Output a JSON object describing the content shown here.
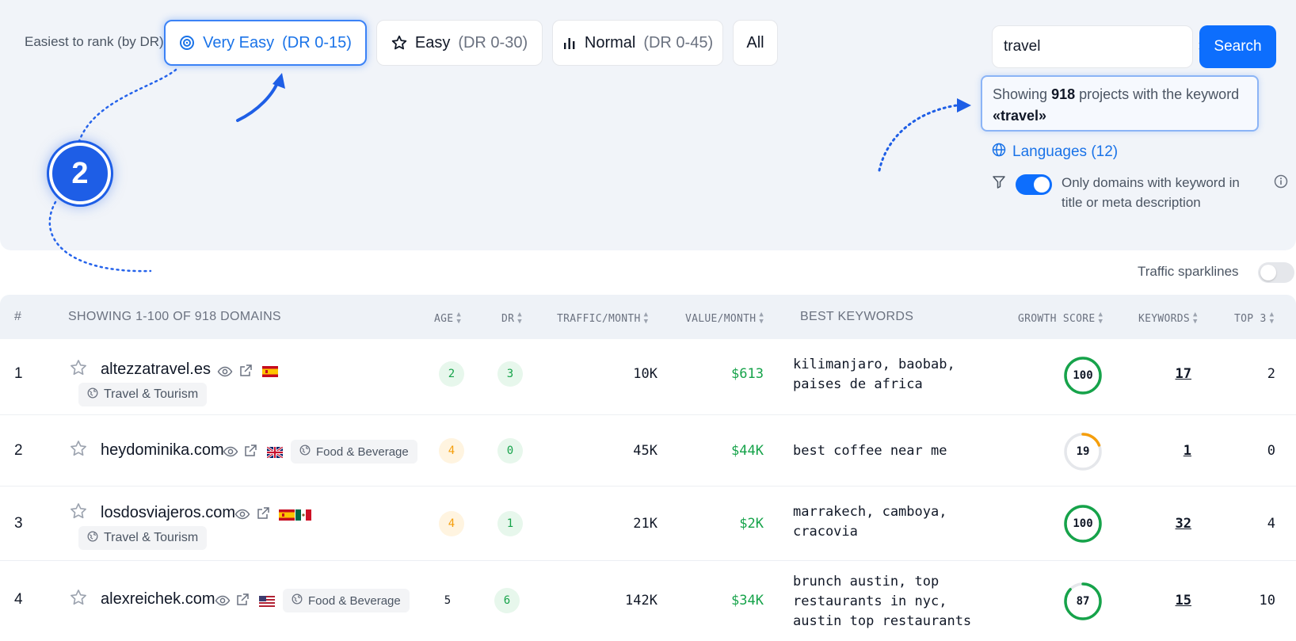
{
  "filters": {
    "label": "Easiest to rank (by DR):",
    "options": [
      {
        "name": "Very Easy",
        "range": "(DR 0-15)",
        "icon": "target-icon",
        "active": true
      },
      {
        "name": "Easy",
        "range": "(DR 0-30)",
        "icon": "star-icon",
        "active": false
      },
      {
        "name": "Normal",
        "range": "(DR 0-45)",
        "icon": "bar-chart-icon",
        "active": false
      },
      {
        "name": "All",
        "range": "",
        "active": false
      }
    ]
  },
  "search": {
    "value": "travel",
    "clear_label": "×",
    "button_label": "Search",
    "result_prefix": "Showing ",
    "result_count": "918",
    "result_suffix": " projects with the keyword",
    "result_keyword": "«travel»"
  },
  "languages_label": "Languages (12)",
  "keyword_filter_label": "Only domains with keyword in title or meta description",
  "annotation_number": "2",
  "sparklines_label": "Traffic sparklines",
  "table": {
    "headers": {
      "num": "#",
      "domains": "SHOWING 1-100 OF 918 DOMAINS",
      "age": "AGE",
      "dr": "DR",
      "traffic": "TRAFFIC/MONTH",
      "value": "VALUE/MONTH",
      "best_keywords": "BEST KEYWORDS",
      "growth": "GROWTH SCORE",
      "keywords": "KEYWORDS",
      "top3": "TOP 3"
    },
    "rows": [
      {
        "num": "1",
        "domain": "altezzatravel.es",
        "category": "Travel & Tourism",
        "age": "2",
        "dr": "3",
        "traffic": "10K",
        "value": "$613",
        "keyword_line1": "kilimanjaro, baobab,",
        "keyword_line2": "paises de africa",
        "keyword_line3": "",
        "growth": 100,
        "keywords": "17",
        "top3": "2"
      },
      {
        "num": "2",
        "domain": "heydominika.com",
        "category": "Food & Beverage",
        "age": "4",
        "dr": "0",
        "traffic": "45K",
        "value": "$44K",
        "keyword_line1": "best coffee near me",
        "keyword_line2": "",
        "keyword_line3": "",
        "growth": 19,
        "keywords": "1",
        "top3": "0"
      },
      {
        "num": "3",
        "domain": "losdosviajeros.com",
        "category": "Travel & Tourism",
        "age": "4",
        "dr": "1",
        "traffic": "21K",
        "value": "$2K",
        "keyword_line1": "marrakech, camboya,",
        "keyword_line2": "cracovia",
        "keyword_line3": "",
        "growth": 100,
        "keywords": "32",
        "top3": "4"
      },
      {
        "num": "4",
        "domain": "alexreichek.com",
        "category": "Food & Beverage",
        "age": "5",
        "dr": "6",
        "traffic": "142K",
        "value": "$34K",
        "keyword_line1": "brunch austin, top",
        "keyword_line2": "restaurants in nyc,",
        "keyword_line3": "austin top restaurants",
        "growth": 87,
        "keywords": "15",
        "top3": "10"
      }
    ]
  },
  "colors": {
    "accent": "#0d6efd",
    "link": "#1a73e8",
    "positive": "#16a34a",
    "warning": "#f59e0b"
  }
}
